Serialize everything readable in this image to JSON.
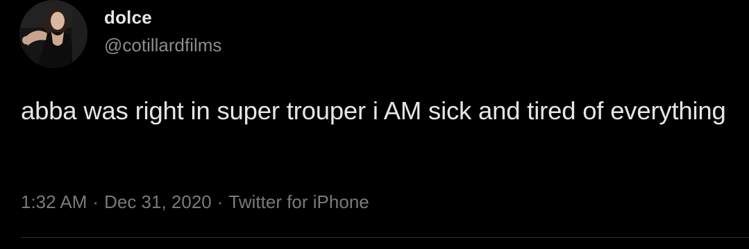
{
  "user": {
    "display_name": "dolce",
    "handle": "@cotillardfilms"
  },
  "tweet": {
    "text": "abba was right in super trouper i AM sick and tired of everything"
  },
  "meta": {
    "time": "1:32 AM",
    "date": "Dec 31, 2020",
    "source": "Twitter for iPhone",
    "separator": "·"
  },
  "colors": {
    "background": "#000000",
    "text_primary": "#e6e6e6",
    "text_secondary": "#8c8c8c",
    "divider": "#2f3336"
  }
}
